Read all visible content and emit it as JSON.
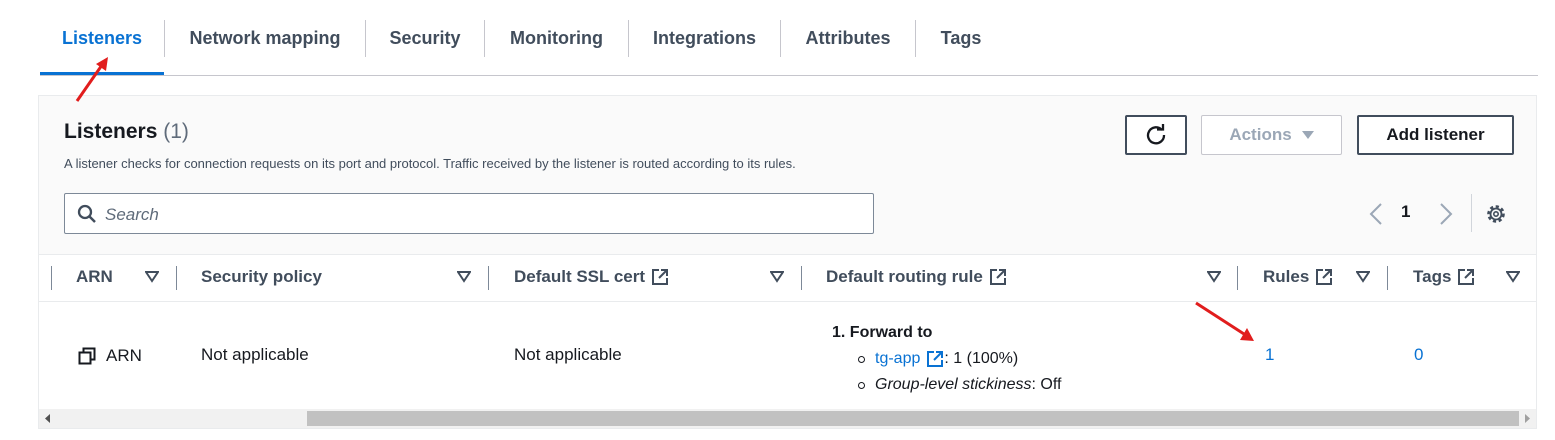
{
  "tabs": [
    {
      "label": "Listeners",
      "active": true
    },
    {
      "label": "Network mapping"
    },
    {
      "label": "Security"
    },
    {
      "label": "Monitoring"
    },
    {
      "label": "Integrations"
    },
    {
      "label": "Attributes"
    },
    {
      "label": "Tags"
    }
  ],
  "panel": {
    "title": "Listeners",
    "count": "(1)",
    "description": "A listener checks for connection requests on its port and protocol. Traffic received by the listener is routed according to its rules.",
    "actions_label": "Actions",
    "add_label": "Add listener",
    "search_placeholder": "Search",
    "page": "1"
  },
  "columns": [
    "ARN",
    "Security policy",
    "Default SSL cert",
    "Default routing rule",
    "Rules",
    "Tags"
  ],
  "row": {
    "arn": "ARN",
    "security_policy": "Not applicable",
    "ssl_cert": "Not applicable",
    "routing": {
      "action": "1. Forward to",
      "target": "tg-app",
      "target_weight": ": 1 (100%)",
      "stickiness_label": "Group-level stickiness",
      "stickiness_value": ": Off"
    },
    "rules": "1",
    "tags": "0"
  },
  "colors": {
    "accent": "#0972d3",
    "annotation": "#e11d1d"
  },
  "icons": [
    "refresh-icon",
    "caret-down-icon",
    "search-icon",
    "chevron-left-icon",
    "chevron-right-icon",
    "gear-icon",
    "sort-icon",
    "external-link-icon",
    "copy-icon"
  ]
}
